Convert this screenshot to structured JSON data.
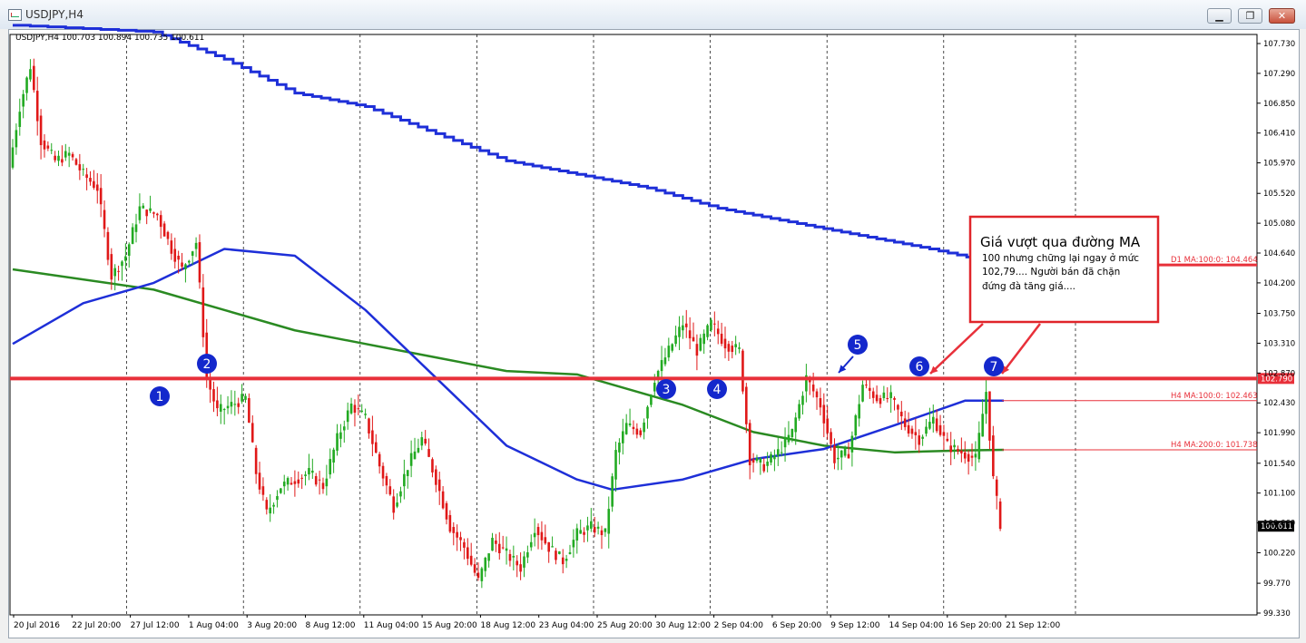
{
  "window": {
    "title": "USDJPY,H4",
    "minimize_glyph": "▁",
    "restore_glyph": "❐",
    "close_glyph": "✕"
  },
  "chart_header": {
    "ohlc_text": "USDJPY,H4  100.703 100.894 100.735 100.611"
  },
  "annotation": {
    "title": "Giá vượt qua đường MA",
    "body": "100 nhưng chững lại ngay ở mức 102,79.... Người bán đã chặn đứng đà tăng giá...."
  },
  "labels": {
    "d1_ma": "D1 MA:100:0: 104.464",
    "h4_ma100": "H4 MA:100:0: 102.463",
    "h4_ma200": "H4 MA:200:0: 101.738",
    "price_line": "102.790",
    "current_price": "100.611"
  },
  "markers": [
    "1",
    "2",
    "3",
    "4",
    "5",
    "6",
    "7"
  ],
  "colors": {
    "price_line": "#e8303a",
    "ma_d1": "#1e2fd8",
    "ma_h4_100": "#1e2fd8",
    "ma_h4_200": "#2a8a22",
    "bull": "#22aa22",
    "bear": "#e01818",
    "marker": "#1428cc",
    "grid": "#000000"
  },
  "chart_data": {
    "type": "candlestick",
    "symbol": "USDJPY",
    "timeframe": "H4",
    "y_ticks": [
      "107.730",
      "107.290",
      "106.850",
      "106.410",
      "105.970",
      "105.520",
      "105.080",
      "104.640",
      "104.200",
      "103.750",
      "103.310",
      "102.870",
      "102.430",
      "101.990",
      "101.540",
      "101.100",
      "100.660",
      "100.220",
      "99.770",
      "99.330"
    ],
    "x_ticks": [
      "20 Jul 2016",
      "22 Jul 20:00",
      "27 Jul 12:00",
      "1 Aug 04:00",
      "3 Aug 20:00",
      "8 Aug 12:00",
      "11 Aug 04:00",
      "15 Aug 20:00",
      "18 Aug 12:00",
      "23 Aug 04:00",
      "25 Aug 20:00",
      "30 Aug 12:00",
      "2 Sep 04:00",
      "6 Sep 20:00",
      "9 Sep 12:00",
      "14 Sep 04:00",
      "16 Sep 20:00",
      "21 Sep 12:00"
    ],
    "ylim": [
      99.33,
      107.73
    ],
    "price_path": [
      [
        0,
        105.9
      ],
      [
        3,
        106.8
      ],
      [
        6,
        107.4
      ],
      [
        9,
        106.3
      ],
      [
        13,
        106.0
      ],
      [
        17,
        106.1
      ],
      [
        21,
        105.8
      ],
      [
        25,
        105.6
      ],
      [
        29,
        104.3
      ],
      [
        33,
        104.6
      ],
      [
        37,
        105.3
      ],
      [
        42,
        105.2
      ],
      [
        46,
        104.7
      ],
      [
        49,
        104.4
      ],
      [
        53,
        104.8
      ],
      [
        56,
        102.8
      ],
      [
        59,
        102.3
      ],
      [
        63,
        102.4
      ],
      [
        67,
        102.5
      ],
      [
        70,
        101.4
      ],
      [
        73,
        100.8
      ],
      [
        77,
        101.2
      ],
      [
        81,
        101.3
      ],
      [
        85,
        101.4
      ],
      [
        89,
        101.2
      ],
      [
        93,
        101.9
      ],
      [
        97,
        102.4
      ],
      [
        101,
        102.2
      ],
      [
        105,
        101.5
      ],
      [
        109,
        100.9
      ],
      [
        113,
        101.5
      ],
      [
        117,
        101.9
      ],
      [
        121,
        101.3
      ],
      [
        125,
        100.6
      ],
      [
        129,
        100.3
      ],
      [
        133,
        99.8
      ],
      [
        137,
        100.4
      ],
      [
        141,
        100.2
      ],
      [
        145,
        100.0
      ],
      [
        149,
        100.6
      ],
      [
        153,
        100.3
      ],
      [
        157,
        100.1
      ],
      [
        161,
        100.5
      ],
      [
        165,
        100.6
      ],
      [
        169,
        100.5
      ],
      [
        172,
        101.7
      ],
      [
        175,
        102.1
      ],
      [
        179,
        102.0
      ],
      [
        183,
        102.8
      ],
      [
        187,
        103.2
      ],
      [
        191,
        103.6
      ],
      [
        195,
        103.2
      ],
      [
        199,
        103.6
      ],
      [
        203,
        103.3
      ],
      [
        207,
        103.2
      ],
      [
        210,
        101.6
      ],
      [
        214,
        101.5
      ],
      [
        218,
        101.7
      ],
      [
        222,
        102.0
      ],
      [
        226,
        102.8
      ],
      [
        230,
        102.4
      ],
      [
        234,
        101.6
      ],
      [
        238,
        101.7
      ],
      [
        242,
        102.7
      ],
      [
        246,
        102.5
      ],
      [
        250,
        102.5
      ],
      [
        254,
        102.1
      ],
      [
        258,
        101.9
      ],
      [
        262,
        102.2
      ],
      [
        266,
        101.8
      ],
      [
        270,
        101.7
      ],
      [
        274,
        101.6
      ],
      [
        277,
        102.6
      ],
      [
        279,
        101.3
      ],
      [
        281,
        100.65
      ]
    ],
    "series": [
      {
        "name": "D1 MA:100:0",
        "values": [
          [
            0,
            108.0
          ],
          [
            40,
            107.9
          ],
          [
            60,
            107.5
          ],
          [
            80,
            107.0
          ],
          [
            100,
            106.8
          ],
          [
            120,
            106.4
          ],
          [
            140,
            106.0
          ],
          [
            160,
            105.8
          ],
          [
            180,
            105.6
          ],
          [
            200,
            105.3
          ],
          [
            220,
            105.1
          ],
          [
            240,
            104.9
          ],
          [
            260,
            104.7
          ],
          [
            281,
            104.464
          ]
        ]
      },
      {
        "name": "H4 MA:100:0",
        "values": [
          [
            0,
            103.3
          ],
          [
            20,
            103.9
          ],
          [
            40,
            104.2
          ],
          [
            60,
            104.7
          ],
          [
            80,
            104.6
          ],
          [
            100,
            103.8
          ],
          [
            120,
            102.8
          ],
          [
            140,
            101.8
          ],
          [
            160,
            101.3
          ],
          [
            170,
            101.15
          ],
          [
            190,
            101.3
          ],
          [
            210,
            101.6
          ],
          [
            230,
            101.75
          ],
          [
            250,
            102.1
          ],
          [
            270,
            102.463
          ],
          [
            281,
            102.463
          ]
        ]
      },
      {
        "name": "H4 MA:200:0",
        "values": [
          [
            0,
            104.4
          ],
          [
            40,
            104.1
          ],
          [
            60,
            103.8
          ],
          [
            80,
            103.5
          ],
          [
            100,
            103.3
          ],
          [
            120,
            103.1
          ],
          [
            140,
            102.9
          ],
          [
            160,
            102.85
          ],
          [
            170,
            102.7
          ],
          [
            190,
            102.4
          ],
          [
            210,
            102.0
          ],
          [
            230,
            101.8
          ],
          [
            250,
            101.7
          ],
          [
            270,
            101.73
          ],
          [
            281,
            101.738
          ]
        ]
      }
    ],
    "horizontal_lines": [
      {
        "label": "102.790",
        "value": 102.79
      }
    ],
    "annotations": [
      "1",
      "2",
      "3",
      "4",
      "5",
      "6",
      "7"
    ]
  }
}
